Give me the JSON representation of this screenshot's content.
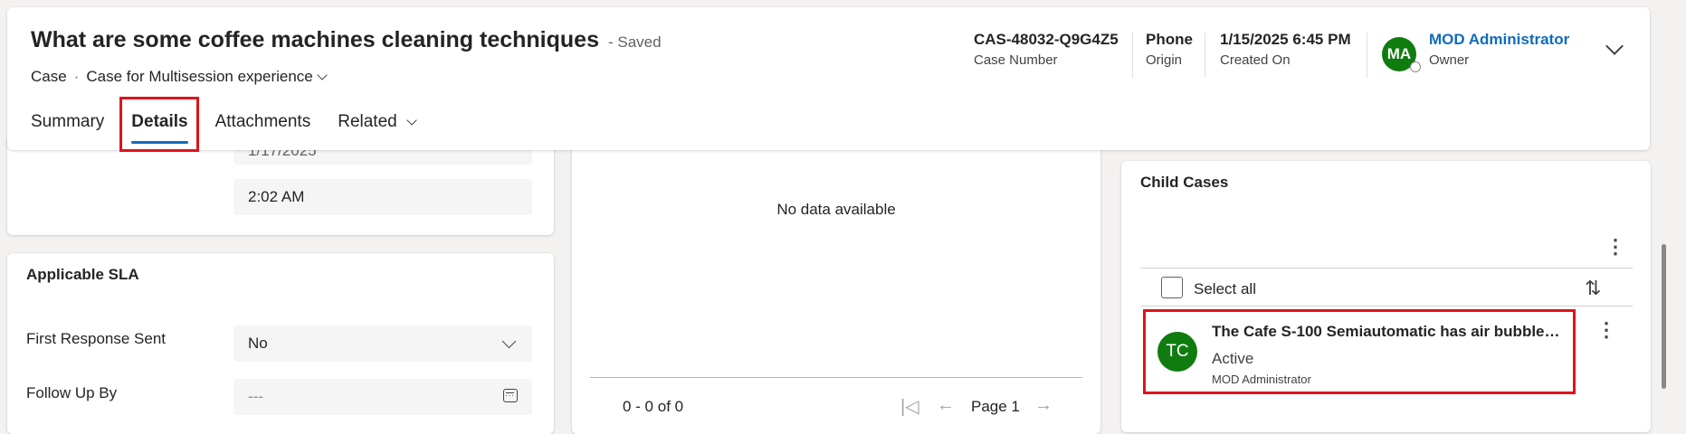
{
  "header": {
    "title": "What are some coffee machines cleaning techniques",
    "saved_status": "- Saved",
    "entity": "Case",
    "separator": "·",
    "form_name": "Case for Multisession experience",
    "tabs": [
      {
        "label": "Summary"
      },
      {
        "label": "Details"
      },
      {
        "label": "Attachments"
      },
      {
        "label": "Related"
      }
    ],
    "meta": {
      "case_number_value": "CAS-48032-Q9G4Z5",
      "case_number_label": "Case Number",
      "origin_value": "Phone",
      "origin_label": "Origin",
      "created_on_value": "1/15/2025 6:45 PM",
      "created_on_label": "Created On",
      "owner_initials": "MA",
      "owner_name": "MOD Administrator",
      "owner_label": "Owner"
    }
  },
  "left_top": {
    "date_partial": "1/17/2025",
    "time_value": "2:02 AM"
  },
  "sla": {
    "title": "Applicable SLA",
    "first_response_label": "First Response Sent",
    "first_response_value": "No",
    "follow_up_label": "Follow Up By",
    "follow_up_value": "---"
  },
  "middle": {
    "no_data": "No data available",
    "count": "0 - 0 of 0",
    "page": "Page 1"
  },
  "child_cases": {
    "title": "Child Cases",
    "select_all": "Select all",
    "rows": [
      {
        "initials": "TC",
        "title": "The Cafe S-100 Semiautomatic has air bubbles i...",
        "status": "Active",
        "owner": "MOD Administrator"
      }
    ]
  },
  "colors": {
    "accent": "#0f6cbd",
    "avatar_green": "#107c10",
    "highlight_red": "#e0131a"
  }
}
